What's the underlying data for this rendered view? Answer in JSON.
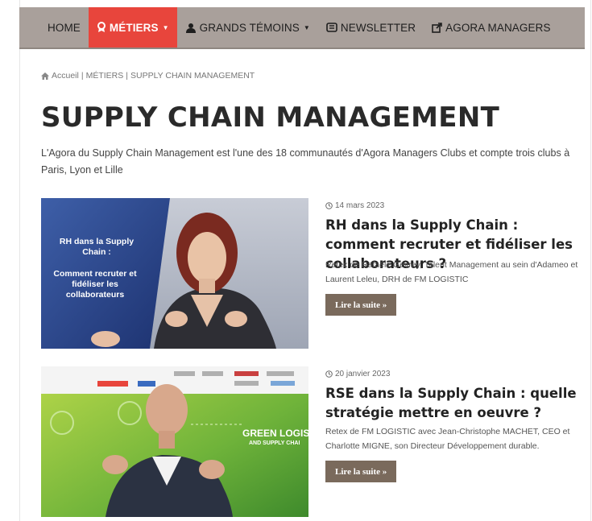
{
  "nav": {
    "items": [
      {
        "label": "HOME",
        "icon": null
      },
      {
        "label": "MÉTIERS",
        "icon": "award-icon",
        "active": true,
        "caret": "▼"
      },
      {
        "label": "GRANDS TÉMOINS",
        "icon": "users-icon",
        "caret": "▼"
      },
      {
        "label": "NEWSLETTER",
        "icon": "newsletter-icon"
      },
      {
        "label": "AGORA MANAGERS",
        "icon": "external-link-icon"
      }
    ]
  },
  "breadcrumb": {
    "home": "Accueil",
    "sep1": "|",
    "section": "MÉTIERS",
    "sep2": "|",
    "current": "SUPPLY CHAIN MANAGEMENT"
  },
  "page": {
    "title": "SUPPLY CHAIN MANAGEMENT",
    "intro": "L'Agora du Supply Chain Management est l'une des 18 communautés d'Agora Managers Clubs et compte trois clubs à Paris, Lyon et Lille"
  },
  "articles": [
    {
      "date": "14 mars 2023",
      "title": "RH dans la Supply Chain : comment recruter et fidéliser les collaborateurs ?",
      "excerpt": "Retex de Rafaële Gevrey, Talent Management au sein d'Adameo et Laurent Leleu, DRH de FM LOGISTIC",
      "button": "Lire la suite »",
      "thumb_text_title": "RH dans la Supply Chain :",
      "thumb_text_sub": "Comment recruter et fidéliser les collaborateurs"
    },
    {
      "date": "20 janvier 2023",
      "title": "RSE dans la Supply Chain : quelle stratégie mettre en oeuvre ?",
      "excerpt": "Retex de FM LOGISTIC avec Jean-Christophe MACHET, CEO et Charlotte MIGNE, son Directeur Développement durable.",
      "button": "Lire la suite »",
      "thumb_text_title": "GREEN LOGIST",
      "thumb_text_sub": "AND SUPPLY CHAI"
    }
  ],
  "colors": {
    "nav_bg": "#a9a09b",
    "nav_active": "#e8453c",
    "button_bg": "#7a6a5c"
  }
}
